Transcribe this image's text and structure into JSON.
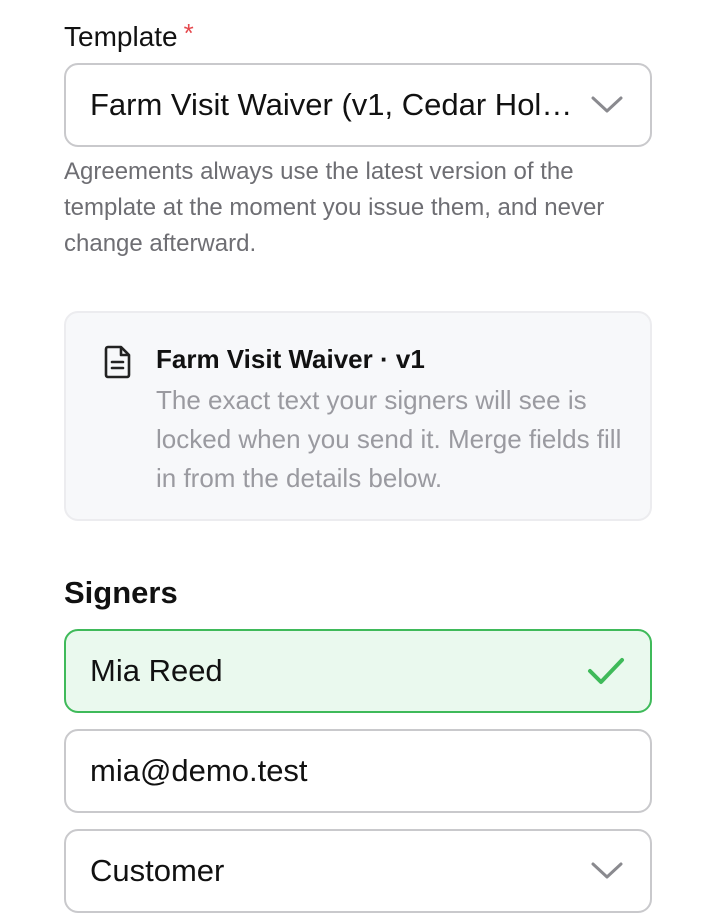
{
  "template_field": {
    "label": "Template",
    "required_mark": "*",
    "selected_value": "Farm Visit Waiver (v1, Cedar Holl…",
    "helper_text": "Agreements always use the latest version of the template at the moment you issue them, and never change afterward."
  },
  "template_preview": {
    "icon": "document-icon",
    "title": "Farm Visit Waiver · v1",
    "body": "The exact text your signers will see is locked when you send it. Merge fields fill in from the details below."
  },
  "signers": {
    "heading": "Signers",
    "name_value": "Mia Reed",
    "email_value": "mia@demo.test",
    "role_value": "Customer"
  },
  "colors": {
    "required": "#e5484d",
    "valid_border": "#3fba5a",
    "valid_background": "#eaf9ee",
    "check": "#3fba5a"
  }
}
